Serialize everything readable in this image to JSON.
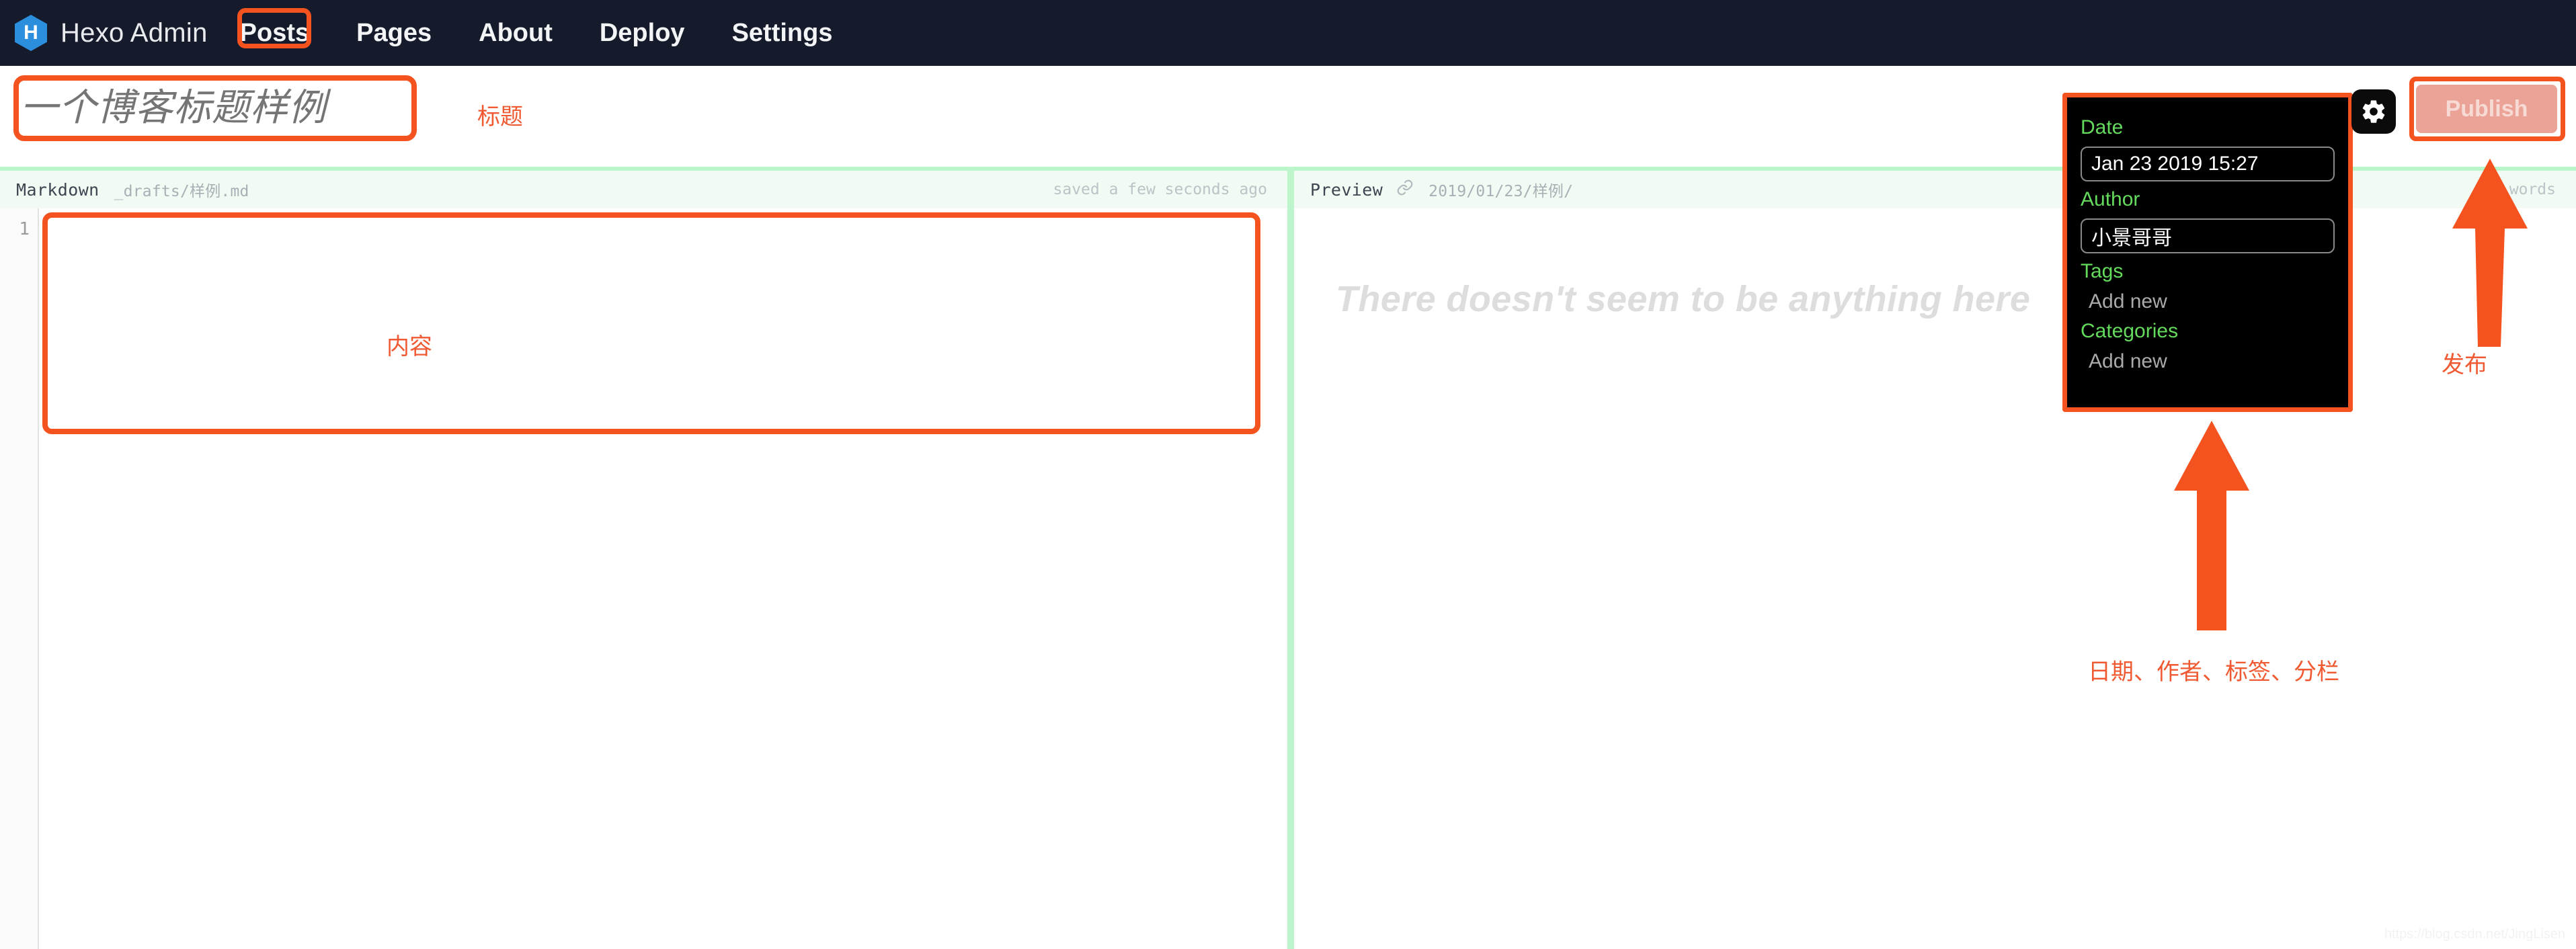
{
  "navbar": {
    "logo_letter": "H",
    "brand": "Hexo Admin",
    "links": [
      {
        "label": "Posts",
        "active": true
      },
      {
        "label": "Pages",
        "active": false
      },
      {
        "label": "About",
        "active": false
      },
      {
        "label": "Deploy",
        "active": false
      },
      {
        "label": "Settings",
        "active": false
      }
    ]
  },
  "title_bar": {
    "title_value": "",
    "title_placeholder": "一个博客标题样例"
  },
  "editor": {
    "head_label": "Markdown",
    "head_path": "_drafts/样例.md",
    "saved_status": "saved a few seconds ago",
    "line_number": "1",
    "content": ""
  },
  "preview": {
    "head_label": "Preview",
    "link_icon": "link-icon",
    "head_path": "2019/01/23/样例/",
    "word_count": "words",
    "empty_message": "There doesn't seem to be anything here"
  },
  "settings_popover": {
    "date_label": "Date",
    "date_value": "Jan 23 2019 15:27",
    "author_label": "Author",
    "author_value": "小景哥哥",
    "tags_label": "Tags",
    "tags_add_new": "Add new",
    "categories_label": "Categories",
    "categories_add_new": "Add new"
  },
  "toolbar": {
    "gear_icon": "gear-icon",
    "publish_label": "Publish"
  },
  "annotations": {
    "title": "标题",
    "content": "内容",
    "settings": "日期、作者、标签、分栏",
    "publish": "发布",
    "color": "#F4531F"
  },
  "watermark": "https://blog.csdn.net/JingLisen"
}
